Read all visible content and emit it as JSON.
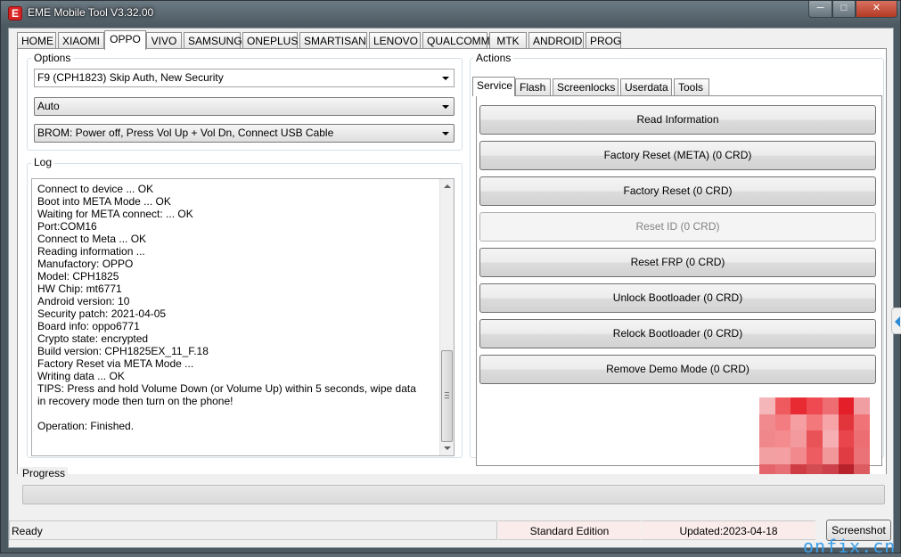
{
  "window": {
    "title": "EME Mobile Tool V3.32.00",
    "icon": "app-logo-icon",
    "icon_glyph": "E"
  },
  "top_tabs": [
    {
      "label": "HOME",
      "active": false
    },
    {
      "label": "XIAOMI",
      "active": false
    },
    {
      "label": "OPPO",
      "active": true
    },
    {
      "label": "VIVO",
      "active": false
    },
    {
      "label": "SAMSUNG",
      "active": false
    },
    {
      "label": "ONEPLUS",
      "active": false
    },
    {
      "label": "SMARTISAN",
      "active": false
    },
    {
      "label": "LENOVO",
      "active": false
    },
    {
      "label": "QUALCOMM",
      "active": false
    },
    {
      "label": "MTK",
      "active": false
    },
    {
      "label": "ANDROID",
      "active": false
    },
    {
      "label": "PROG",
      "active": false
    }
  ],
  "options": {
    "label": "Options",
    "model_select": "F9 (CPH1823) Skip Auth, New Security",
    "port_select": "Auto",
    "boot_mode_select": "BROM: Power off, Press Vol Up + Vol Dn, Connect USB Cable"
  },
  "log": {
    "label": "Log",
    "lines": [
      "Connect to device ... OK",
      "Boot into META Mode ... OK",
      "Waiting for META connect: ... OK",
      "Port:COM16",
      "Connect to Meta ... OK",
      "Reading information ...",
      "Manufactory: OPPO",
      "Model: CPH1825",
      "HW Chip: mt6771",
      "Android version: 10",
      "Security patch: 2021-04-05",
      "Board info: oppo6771",
      "Crypto state: encrypted",
      "Build version: CPH1825EX_11_F.18",
      "Factory Reset via META Mode ...",
      "Writing data ... OK",
      "TIPS: Press and hold Volume Down (or Volume Up) within 5 seconds, wipe data",
      "in recovery mode then turn on the phone!",
      "",
      "Operation: Finished."
    ]
  },
  "actions": {
    "label": "Actions",
    "tabs": [
      {
        "label": "Service",
        "active": true
      },
      {
        "label": "Flash",
        "active": false
      },
      {
        "label": "Screenlocks",
        "active": false
      },
      {
        "label": "Userdata",
        "active": false
      },
      {
        "label": "Tools",
        "active": false
      }
    ],
    "buttons": [
      {
        "label": "Read Information",
        "enabled": true
      },
      {
        "label": "Factory Reset (META) (0 CRD)",
        "enabled": true
      },
      {
        "label": "Factory Reset (0 CRD)",
        "enabled": true
      },
      {
        "label": "Reset ID (0 CRD)",
        "enabled": false
      },
      {
        "label": "Reset FRP (0 CRD)",
        "enabled": true
      },
      {
        "label": "Unlock Bootloader (0 CRD)",
        "enabled": true
      },
      {
        "label": "Relock Bootloader (0 CRD)",
        "enabled": true
      },
      {
        "label": "Remove Demo Mode (0 CRD)",
        "enabled": true
      }
    ]
  },
  "progress": {
    "label": "Progress",
    "value": 0
  },
  "status": {
    "ready": "Ready",
    "edition": "Standard Edition",
    "updated": "Updated:2023-04-18",
    "screenshot_button": "Screenshot"
  },
  "watermark": "onfix.cn",
  "colors": {
    "close_button": "#c4462f",
    "disabled_text": "#838383",
    "status_highlight": "#fbecec",
    "watermark": "#3a9ee8"
  }
}
